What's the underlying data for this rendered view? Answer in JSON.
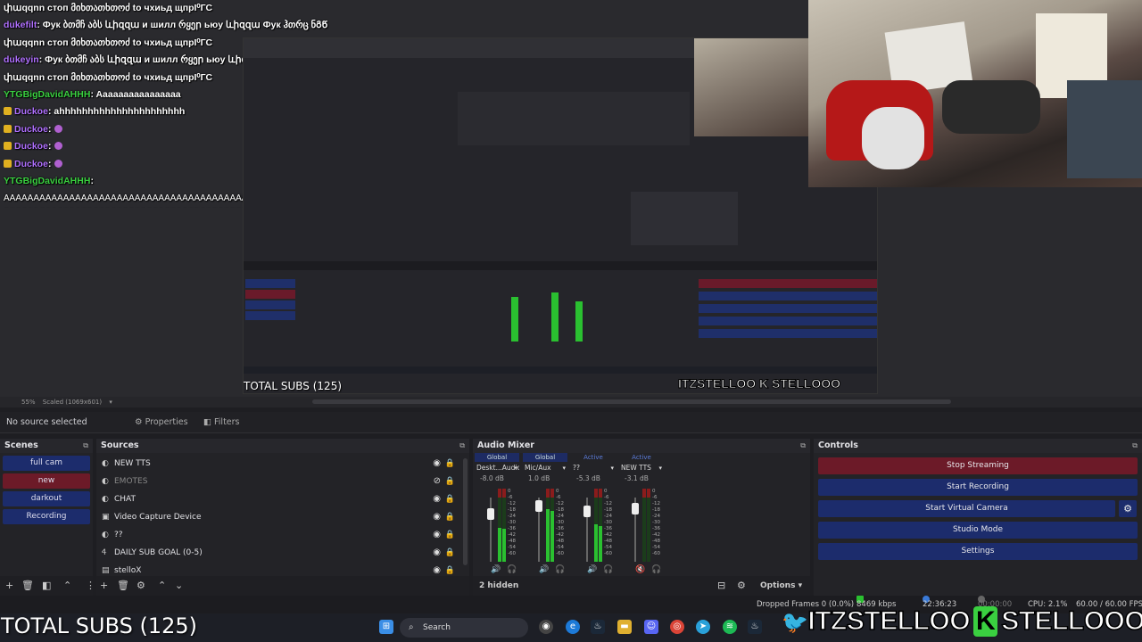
{
  "chat": {
    "lines": [
      {
        "user": "",
        "text": "փաqqnn стоп მიხთათხთოძ to чхиьд щпрІ⁰ГС",
        "color": "#ffffff",
        "badge": false,
        "emote": false
      },
      {
        "user": "dukefilt",
        "text": ": Фук ბთმჩ აბს ևիզզա и шилл რყეր ьюу ևիզզա Фук ჰთრც ნᲒᲬ",
        "color": "#b070ff",
        "badge": false,
        "emote": false
      },
      {
        "user": "",
        "text": "փաqqnn стоп მიხთათხთოძ to чхиьд щпрІ⁰ГС",
        "color": "#ffffff",
        "badge": false,
        "emote": false
      },
      {
        "user": "dukeyin",
        "text": ": Фук ბთმჩ აბს ևիզզա и шилл რყეր ьюу ևիզզա Фук ჰთრც ნᲒᲬ",
        "color": "#b070ff",
        "badge": false,
        "emote": false
      },
      {
        "user": "",
        "text": "փաqqnn стоп მიხთათხთოძ to чхиьд щпрІ⁰ГС",
        "color": "#ffffff",
        "badge": false,
        "emote": false
      },
      {
        "user": "YTGBigDavidAHHH",
        "text": ": Aaaaaaaaaaaaaaaa",
        "color": "#3ad040",
        "badge": false,
        "emote": false
      },
      {
        "user": "Duckoe",
        "text": ": ahhhhhhhhhhhhhhhhhhhhhh",
        "color": "#b070ff",
        "badge": true,
        "emote": false
      },
      {
        "user": "Duckoe",
        "text": ":",
        "color": "#b070ff",
        "badge": true,
        "emote": true
      },
      {
        "user": "Duckoe",
        "text": ":",
        "color": "#b070ff",
        "badge": true,
        "emote": true
      },
      {
        "user": "Duckoe",
        "text": ":",
        "color": "#b070ff",
        "badge": true,
        "emote": true
      },
      {
        "user": "YTGBigDavidAHHH",
        "text": ":",
        "color": "#3ad040",
        "badge": false,
        "emote": false
      }
    ],
    "spam": "AAAAAAAAAAAAAAAAAAAAAAAAAAAAAAAAAAAAAAAAAAAAAAAAAAAAAAAAAAAAAAAAAAAAAAAAAAAAAAAAAAAAAAAAAAAAAAAAAAAAAAAAAAAAAAAAAAAAAAAAAAAAAAAAAAAAAAAAAAAAAAAAAAAAAAAAAAAAAAAAAAAAAAAAAAAAAAAAAAAAAAAAAAAAAAAAAAAAAAAAAAAAAAAAAAAAAAAAAAAAAAAAAAAAAAAAAAAAAAAAAAAAAAAAAAAAAAAAAAAAAAAAAAAAAAAAAAAAAAAAAAAAAAAAAAAAAAAAAAAAAAAAAAAAAAAAAAAAAAAAAAAAAAAAAAAAAAAAAAAAAAAAAAAAAAAAAAAAAAAAAAAAAAAAAAAAAAAAAAAAAAAAAAAAAAAAAAAAAAAA"
  },
  "preview": {
    "subs": "TOTAL SUBS (125)",
    "brand": "ITZSTELLOO K STELLOOO"
  },
  "zoombar": {
    "zoom": "55%",
    "scale": "Scaled (1069x601)"
  },
  "context": {
    "no_source": "No source selected",
    "properties": "Properties",
    "filters": "Filters"
  },
  "scenes": {
    "title": "Scenes",
    "items": [
      {
        "label": "full cam",
        "active": false
      },
      {
        "label": "new",
        "active": true
      },
      {
        "label": "darkout",
        "active": false
      },
      {
        "label": "Recording",
        "active": false
      }
    ]
  },
  "sources": {
    "title": "Sources",
    "items": [
      {
        "label": "NEW TTS",
        "icon": "◐",
        "dim": false
      },
      {
        "label": "EMOTES",
        "icon": "◐",
        "dim": true
      },
      {
        "label": "CHAT",
        "icon": "◐",
        "dim": false
      },
      {
        "label": "Video Capture Device",
        "icon": "▣",
        "dim": false
      },
      {
        "label": "??",
        "icon": "◐",
        "dim": false
      },
      {
        "label": "DAILY SUB GOAL (0-5)",
        "icon": "Ꮞ",
        "dim": false
      },
      {
        "label": "stelloX",
        "icon": "▤",
        "dim": false
      }
    ]
  },
  "mixer": {
    "title": "Audio Mixer",
    "channels": [
      {
        "tag": "Global",
        "active": false,
        "name": "Deskt...Audio",
        "db": "-8.0 dB",
        "level": 0.55,
        "fader": 0.8,
        "muted": false,
        "monitor": false
      },
      {
        "tag": "Global",
        "active": false,
        "name": "Mic/Aux",
        "db": "1.0 dB",
        "level": 0.85,
        "fader": 0.95,
        "muted": false,
        "monitor": false
      },
      {
        "tag": "Active",
        "active": true,
        "name": "??",
        "db": "-5.3 dB",
        "level": 0.6,
        "fader": 0.85,
        "muted": false,
        "monitor": true
      },
      {
        "tag": "Active",
        "active": true,
        "name": "NEW TTS",
        "db": "-3.1 dB",
        "level": 0.0,
        "fader": 0.9,
        "muted": true,
        "monitor": false
      }
    ],
    "scale": [
      "0",
      "-6",
      "-12",
      "-18",
      "-24",
      "-30",
      "-36",
      "-42",
      "-48",
      "-54",
      "-60"
    ],
    "hidden": "2 hidden",
    "options": "Options"
  },
  "controls": {
    "title": "Controls",
    "stop_streaming": "Stop Streaming",
    "start_recording": "Start Recording",
    "start_virtual_camera": "Start Virtual Camera",
    "studio_mode": "Studio Mode",
    "settings": "Settings"
  },
  "status": {
    "dropped": "Dropped Frames 0 (0.0%)",
    "bitrate": "8469 kbps",
    "stream_time": "22:36:23",
    "rec_time": "00:00:00",
    "cpu": "CPU: 2.1%",
    "fps": "60.00 / 60.00 FPS"
  },
  "taskbar": {
    "search": "Search"
  },
  "overlay": {
    "subs": "TOTAL SUBS (125)",
    "brand_left": "ITZSTELLOO",
    "brand_k": "K",
    "brand_right": "STELLOOO"
  },
  "colors": {
    "accent_blue": "#1c2c6c",
    "accent_red": "#6c1a28",
    "meter_green": "#2ac030"
  }
}
